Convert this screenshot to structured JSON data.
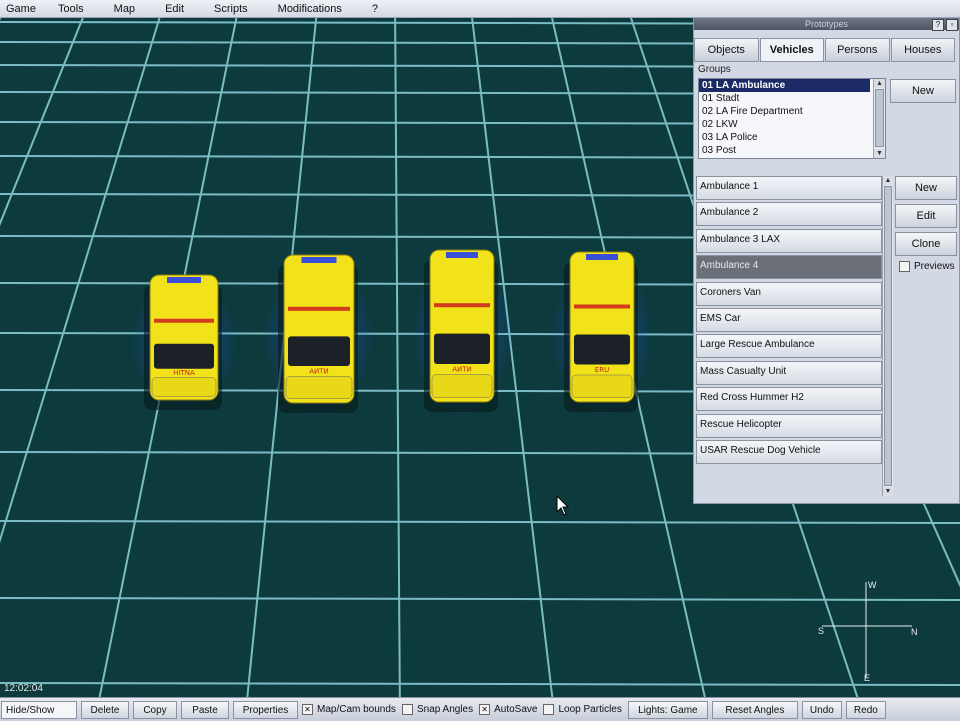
{
  "menu": [
    "Game",
    "Tools",
    "Map",
    "Edit",
    "Scripts",
    "Modifications",
    "?"
  ],
  "panel": {
    "title": "Prototypes",
    "help_glyph": "?",
    "tabs": [
      {
        "label": "Objects",
        "active": false
      },
      {
        "label": "Vehicles",
        "active": true
      },
      {
        "label": "Persons",
        "active": false
      },
      {
        "label": "Houses",
        "active": false
      }
    ],
    "groups_label": "Groups",
    "groups": [
      "01 LA Ambulance",
      "01 Stadt",
      "02 LA Fire Department",
      "02 LKW",
      "03 LA Police",
      "03 Post"
    ],
    "selected_group": 0,
    "groups_new_label": "New",
    "vehicles": [
      "Ambulance 1",
      "Ambulance 2",
      "Ambulance 3 LAX",
      "Ambulance 4",
      "Coroners Van",
      "EMS Car",
      "Large Rescue Ambulance",
      "Mass Casualty Unit",
      "Red Cross Hummer H2",
      "Rescue Helicopter",
      "USAR Rescue Dog Vehicle"
    ],
    "selected_vehicle": 3,
    "buttons": {
      "new": "New",
      "edit": "Edit",
      "clone": "Clone"
    },
    "previews_label": "Previews",
    "previews_checked": false
  },
  "vehicle_markings": [
    "HITNA",
    "AИTИ",
    "AИTИ",
    "ERU"
  ],
  "clock": "12:02:04",
  "toolbar": {
    "hide_show": "Hide/Show",
    "delete": "Delete",
    "copy": "Copy",
    "paste": "Paste",
    "properties": "Properties",
    "map_cam_bounds": {
      "label": "Map/Cam bounds",
      "checked": true
    },
    "snap_angles": {
      "label": "Snap Angles",
      "checked": false
    },
    "autosave": {
      "label": "AutoSave",
      "checked": true
    },
    "loop_particles": {
      "label": "Loop Particles",
      "checked": false
    },
    "lights": "Lights: Game",
    "reset_angles": "Reset Angles",
    "undo": "Undo",
    "redo": "Redo"
  },
  "compass": {
    "north": "N",
    "south": "S",
    "east": "E",
    "west": "W"
  },
  "colors": {
    "grid_line": "#8fd3dc",
    "ground": "#0d3a3c",
    "vehicle_yellow": "#f2e21a",
    "selection": "#1c2a66"
  }
}
